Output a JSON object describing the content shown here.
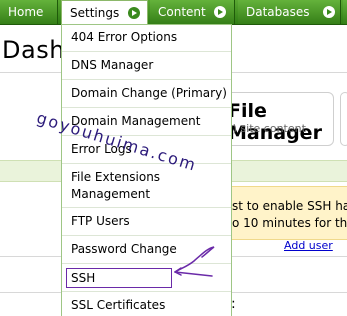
{
  "nav": {
    "tabs": [
      {
        "label": "Home"
      },
      {
        "label": "Settings"
      },
      {
        "label": "Content"
      },
      {
        "label": "Databases"
      }
    ]
  },
  "page": {
    "title": "Dash",
    "file_manager_title": "File Manager",
    "file_manager_sub": "P) site content",
    "notice_line1": "st to enable SSH has",
    "notice_line2": "o 10 minutes for th",
    "add_user": "Add user",
    "colon": ":"
  },
  "menu": {
    "items": [
      {
        "label": "404 Error Options"
      },
      {
        "label": "DNS Manager"
      },
      {
        "label": "Domain Change (Primary)"
      },
      {
        "label": "Domain Management"
      },
      {
        "label": "Error Logs"
      },
      {
        "label": "File Extensions"
      },
      {
        "label": "Management"
      },
      {
        "label": "FTP Users"
      },
      {
        "label": "Password Change"
      },
      {
        "label": "SSH"
      },
      {
        "label": "SSL Certificates"
      }
    ],
    "highlighted": "SSH"
  },
  "watermark": "goyouhuima.com",
  "colors": {
    "nav_green": "#3a8a1e",
    "highlight_box": "#6a2aa8",
    "notice_bg": "#fff3c9",
    "link": "#0000cc"
  },
  "icons": {
    "tab_arrow": "chevron-right-circle-icon"
  }
}
